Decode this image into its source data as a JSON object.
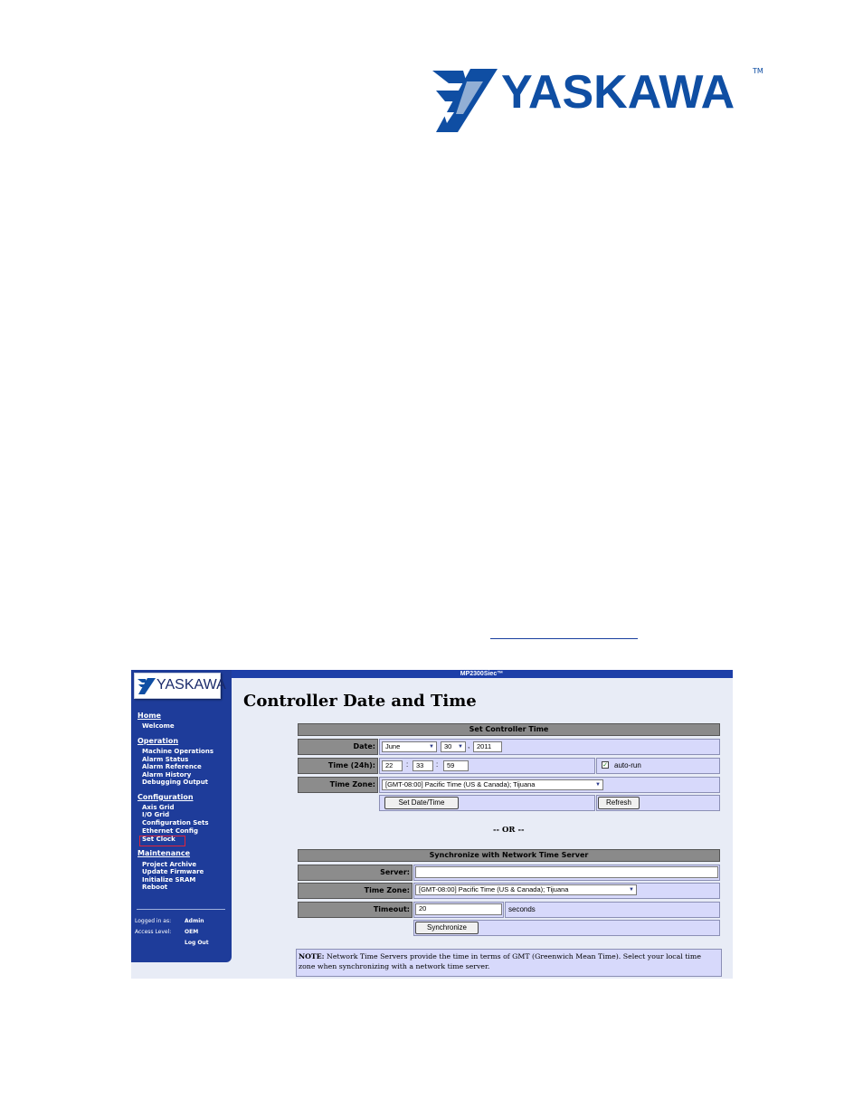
{
  "brand": {
    "name": "YASKAWA",
    "trademark": "TM"
  },
  "app": {
    "title": "MP2300Siec™",
    "page_heading": "Controller Date and Time"
  },
  "sidebar": {
    "logo_text": "YASKAWA",
    "sections": [
      {
        "label": "Home",
        "items": [
          "Welcome"
        ]
      },
      {
        "label": "Operation",
        "items": [
          "Machine Operations",
          "Alarm Status",
          "Alarm Reference",
          "Alarm History",
          "Debugging Output"
        ]
      },
      {
        "label": "Configuration",
        "items": [
          "Axis Grid",
          "I/O Grid",
          "Configuration Sets",
          "Ethernet Config",
          "Set Clock"
        ]
      },
      {
        "label": "Maintenance",
        "items": [
          "Project Archive",
          "Update Firmware",
          "Initialize SRAM",
          "Reboot"
        ]
      }
    ],
    "logged_in_label": "Logged in as:",
    "logged_in_value": "Admin",
    "access_label": "Access Level:",
    "access_value": "OEM",
    "logout": "Log Out"
  },
  "set_time": {
    "header": "Set Controller Time",
    "date_label": "Date:",
    "month": "June",
    "day": "30",
    "year": "2011",
    "time_label": "Time (24h):",
    "hour": "22",
    "minute": "33",
    "second": "59",
    "autorun_label": "auto-run",
    "autorun_checked": true,
    "tz_label": "Time Zone:",
    "tz_value": "[GMT-08:00] Pacific Time (US & Canada); Tijuana",
    "set_button": "Set Date/Time",
    "refresh_button": "Refresh"
  },
  "or_text": "-- OR --",
  "sync": {
    "header": "Synchronize with Network Time Server",
    "server_label": "Server:",
    "server_value": "",
    "tz_label": "Time Zone:",
    "tz_value": "[GMT-08:00] Pacific Time (US & Canada); Tijuana",
    "timeout_label": "Timeout:",
    "timeout_value": "20",
    "timeout_unit": "seconds",
    "sync_button": "Synchronize"
  },
  "note": {
    "label": "NOTE:",
    "text": " Network Time Servers provide the time in terms of GMT (Greenwich Mean Time). Select your local time zone when synchronizing with a network time server."
  }
}
